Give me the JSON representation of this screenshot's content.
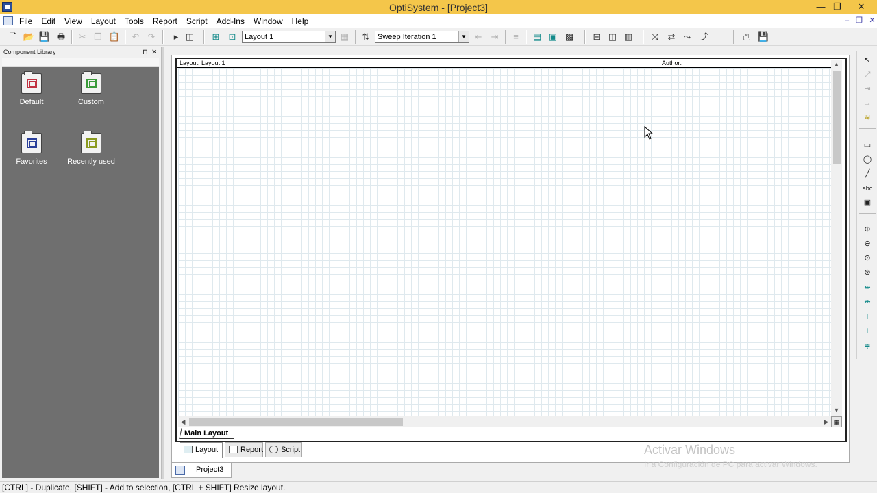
{
  "window": {
    "title": "OptiSystem - [Project3]",
    "minimize": "—",
    "restore": "❐",
    "close": "✕"
  },
  "menubar": {
    "items": [
      "File",
      "Edit",
      "View",
      "Layout",
      "Tools",
      "Report",
      "Script",
      "Add-Ins",
      "Window",
      "Help"
    ],
    "mdi_minimize": "–",
    "mdi_restore": "❐",
    "mdi_close": "✕"
  },
  "toolbar": {
    "layout_combo": "Layout 1",
    "sweep_combo": "Sweep Iteration 1",
    "icons": [
      "new-icon",
      "open-icon",
      "save-icon",
      "print-icon",
      "cut-icon",
      "copy-icon",
      "paste-icon",
      "undo-icon",
      "redo-icon",
      "run-icon",
      "stop-icon",
      "add-layout-icon",
      "layout-icon",
      "layout-settings-icon",
      "sweep-icon"
    ]
  },
  "component_library": {
    "title": "Component Library",
    "folders": [
      {
        "label": "Default"
      },
      {
        "label": "Custom"
      },
      {
        "label": "Favorites"
      },
      {
        "label": "Recently used"
      }
    ]
  },
  "canvas": {
    "layout_label": "Layout: Layout 1",
    "author_label": "Author:",
    "main_layout_tab": "Main Layout"
  },
  "view_tabs": [
    {
      "label": "Layout",
      "active": true
    },
    {
      "label": "Report",
      "active": false
    },
    {
      "label": "Script",
      "active": false
    }
  ],
  "document_tab": {
    "label": "Project3"
  },
  "watermark": {
    "line1": "Activar Windows",
    "line2": "Ir a Configuración de PC para activar Windows."
  },
  "statusbar": {
    "text": "[CTRL] - Duplicate, [SHIFT] - Add to selection, [CTRL + SHIFT] Resize layout."
  },
  "colors": {
    "titlebar": "#f4c64a",
    "library_background": "#6f6f6f",
    "grid_line": "#dfe9ee",
    "default_folder_accent": "#c03040",
    "custom_folder_accent": "#3a9a3a",
    "favorites_folder_accent": "#2a3f9a",
    "recent_folder_accent": "#8a9a20"
  }
}
